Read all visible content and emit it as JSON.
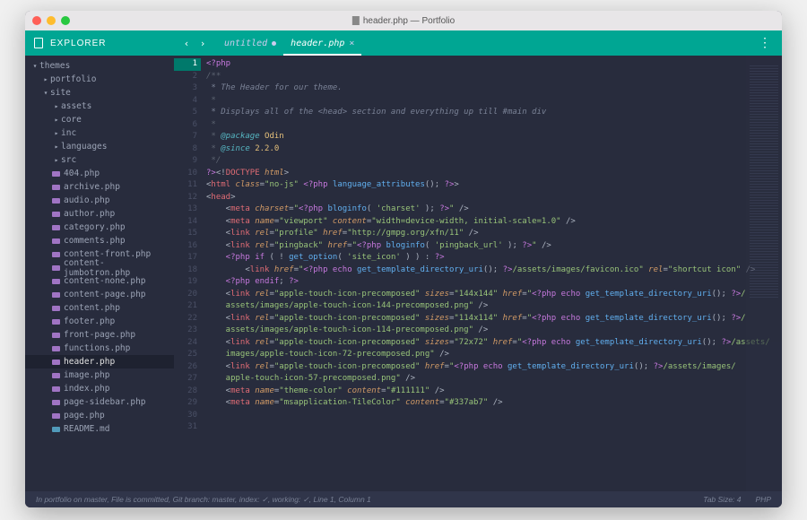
{
  "window": {
    "title": "header.php — Portfolio"
  },
  "sidebar": {
    "title": "EXPLORER",
    "tree": [
      {
        "label": "themes",
        "type": "folder",
        "indent": 0,
        "expanded": true
      },
      {
        "label": "portfolio",
        "type": "folder",
        "indent": 1,
        "expanded": false
      },
      {
        "label": "site",
        "type": "folder",
        "indent": 1,
        "expanded": true
      },
      {
        "label": "assets",
        "type": "folder",
        "indent": 2,
        "expanded": false
      },
      {
        "label": "core",
        "type": "folder",
        "indent": 2,
        "expanded": false
      },
      {
        "label": "inc",
        "type": "folder",
        "indent": 2,
        "expanded": false
      },
      {
        "label": "languages",
        "type": "folder",
        "indent": 2,
        "expanded": false
      },
      {
        "label": "src",
        "type": "folder",
        "indent": 2,
        "expanded": false
      },
      {
        "label": "404.php",
        "type": "php",
        "indent": 2
      },
      {
        "label": "archive.php",
        "type": "php",
        "indent": 2
      },
      {
        "label": "audio.php",
        "type": "php",
        "indent": 2
      },
      {
        "label": "author.php",
        "type": "php",
        "indent": 2
      },
      {
        "label": "category.php",
        "type": "php",
        "indent": 2
      },
      {
        "label": "comments.php",
        "type": "php",
        "indent": 2
      },
      {
        "label": "content-front.php",
        "type": "php",
        "indent": 2
      },
      {
        "label": "content-jumbotron.php",
        "type": "php",
        "indent": 2
      },
      {
        "label": "content-none.php",
        "type": "php",
        "indent": 2
      },
      {
        "label": "content-page.php",
        "type": "php",
        "indent": 2
      },
      {
        "label": "content.php",
        "type": "php",
        "indent": 2
      },
      {
        "label": "footer.php",
        "type": "php",
        "indent": 2
      },
      {
        "label": "front-page.php",
        "type": "php",
        "indent": 2
      },
      {
        "label": "functions.php",
        "type": "php",
        "indent": 2
      },
      {
        "label": "header.php",
        "type": "php",
        "indent": 2,
        "active": true
      },
      {
        "label": "image.php",
        "type": "php",
        "indent": 2
      },
      {
        "label": "index.php",
        "type": "php",
        "indent": 2
      },
      {
        "label": "page-sidebar.php",
        "type": "php",
        "indent": 2
      },
      {
        "label": "page.php",
        "type": "php",
        "indent": 2
      },
      {
        "label": "README.md",
        "type": "md",
        "indent": 2
      }
    ]
  },
  "tabs": [
    {
      "label": "untitled",
      "modified": true,
      "active": false
    },
    {
      "label": "header.php",
      "modified": false,
      "active": true
    }
  ],
  "code_lines": [
    {
      "n": 1,
      "segs": [
        [
          "<?",
          "kw"
        ],
        [
          "php",
          "kw"
        ]
      ],
      "cur": true
    },
    {
      "n": 2,
      "segs": [
        [
          "/**",
          "cm"
        ]
      ]
    },
    {
      "n": 3,
      "segs": [
        [
          " * The Header for our theme.",
          "cm2"
        ]
      ]
    },
    {
      "n": 4,
      "segs": [
        [
          " *",
          "cm"
        ]
      ]
    },
    {
      "n": 5,
      "segs": [
        [
          " * Displays all of the <head> section and everything up till #main div",
          "cm2"
        ]
      ]
    },
    {
      "n": 6,
      "segs": [
        [
          " *",
          "cm"
        ]
      ]
    },
    {
      "n": 7,
      "segs": [
        [
          " * ",
          "cm"
        ],
        [
          "@package",
          "pkg"
        ],
        [
          " Odin",
          "var"
        ]
      ]
    },
    {
      "n": 8,
      "segs": [
        [
          " * ",
          "cm"
        ],
        [
          "@since",
          "pkg"
        ],
        [
          " 2.2.0",
          "var"
        ]
      ]
    },
    {
      "n": 9,
      "segs": [
        [
          " */",
          "cm"
        ]
      ]
    },
    {
      "n": 10,
      "segs": [
        [
          "?>",
          "kw"
        ],
        [
          "<!",
          "punc"
        ],
        [
          "DOCTYPE",
          "tag"
        ],
        [
          " html",
          "attr"
        ],
        [
          ">",
          "punc"
        ]
      ]
    },
    {
      "n": 11,
      "segs": [
        [
          "<",
          "punc"
        ],
        [
          "html",
          "tag"
        ],
        [
          " class",
          "attr"
        ],
        [
          "=",
          "punc"
        ],
        [
          "\"no-js\"",
          "str"
        ],
        [
          " <?",
          "kw"
        ],
        [
          "php",
          "kw"
        ],
        [
          " language_attributes",
          "fn"
        ],
        [
          "(); ",
          "punc"
        ],
        [
          "?>",
          "kw"
        ],
        [
          ">",
          "punc"
        ]
      ]
    },
    {
      "n": 12,
      "segs": [
        [
          "<",
          "punc"
        ],
        [
          "head",
          "tag"
        ],
        [
          ">",
          "punc"
        ]
      ]
    },
    {
      "n": 13,
      "segs": [
        [
          "    <",
          "punc"
        ],
        [
          "meta",
          "tag"
        ],
        [
          " charset",
          "attr"
        ],
        [
          "=",
          "punc"
        ],
        [
          "\"",
          "str"
        ],
        [
          "<?",
          "kw"
        ],
        [
          "php",
          "kw"
        ],
        [
          " bloginfo",
          "fn"
        ],
        [
          "( ",
          "punc"
        ],
        [
          "'charset'",
          "str"
        ],
        [
          " ); ",
          "punc"
        ],
        [
          "?>",
          "kw"
        ],
        [
          "\"",
          "str"
        ],
        [
          " />",
          "punc"
        ]
      ]
    },
    {
      "n": 14,
      "segs": [
        [
          "    <",
          "punc"
        ],
        [
          "meta",
          "tag"
        ],
        [
          " name",
          "attr"
        ],
        [
          "=",
          "punc"
        ],
        [
          "\"viewport\"",
          "str"
        ],
        [
          " content",
          "attr"
        ],
        [
          "=",
          "punc"
        ],
        [
          "\"width=device-width, initial-scale=1.0\"",
          "str"
        ],
        [
          " />",
          "punc"
        ]
      ]
    },
    {
      "n": 15,
      "segs": [
        [
          "    <",
          "punc"
        ],
        [
          "link",
          "tag"
        ],
        [
          " rel",
          "attr"
        ],
        [
          "=",
          "punc"
        ],
        [
          "\"profile\"",
          "str"
        ],
        [
          " href",
          "attr"
        ],
        [
          "=",
          "punc"
        ],
        [
          "\"http://gmpg.org/xfn/11\"",
          "str"
        ],
        [
          " />",
          "punc"
        ]
      ]
    },
    {
      "n": 16,
      "segs": [
        [
          "    <",
          "punc"
        ],
        [
          "link",
          "tag"
        ],
        [
          " rel",
          "attr"
        ],
        [
          "=",
          "punc"
        ],
        [
          "\"pingback\"",
          "str"
        ],
        [
          " href",
          "attr"
        ],
        [
          "=",
          "punc"
        ],
        [
          "\"",
          "str"
        ],
        [
          "<?",
          "kw"
        ],
        [
          "php",
          "kw"
        ],
        [
          " bloginfo",
          "fn"
        ],
        [
          "( ",
          "punc"
        ],
        [
          "'pingback_url'",
          "str"
        ],
        [
          " ); ",
          "punc"
        ],
        [
          "?>",
          "kw"
        ],
        [
          "\"",
          "str"
        ],
        [
          " />",
          "punc"
        ]
      ]
    },
    {
      "n": 17,
      "segs": [
        [
          "    <?",
          "kw"
        ],
        [
          "php",
          "kw"
        ],
        [
          " if",
          "kw"
        ],
        [
          " ( ! ",
          "punc"
        ],
        [
          "get_option",
          "fn"
        ],
        [
          "( ",
          "punc"
        ],
        [
          "'site_icon'",
          "str"
        ],
        [
          " ) ) : ",
          "punc"
        ],
        [
          "?>",
          "kw"
        ]
      ]
    },
    {
      "n": 18,
      "segs": [
        [
          "        <",
          "punc"
        ],
        [
          "link",
          "tag"
        ],
        [
          " href",
          "attr"
        ],
        [
          "=",
          "punc"
        ],
        [
          "\"",
          "str"
        ],
        [
          "<?",
          "kw"
        ],
        [
          "php",
          "kw"
        ],
        [
          " echo",
          "kw"
        ],
        [
          " get_template_directory_uri",
          "fn"
        ],
        [
          "(); ",
          "punc"
        ],
        [
          "?>",
          "kw"
        ],
        [
          "/assets/images/favicon.ico\"",
          "str"
        ],
        [
          " rel",
          "attr"
        ],
        [
          "=",
          "punc"
        ],
        [
          "\"shortcut icon\"",
          "str"
        ],
        [
          " />",
          "punc"
        ]
      ]
    },
    {
      "n": 19,
      "segs": [
        [
          "    <?",
          "kw"
        ],
        [
          "php",
          "kw"
        ],
        [
          " endif",
          "kw"
        ],
        [
          "; ",
          "punc"
        ],
        [
          "?>",
          "kw"
        ]
      ]
    },
    {
      "n": 20,
      "segs": [
        [
          "",
          "punc"
        ]
      ]
    },
    {
      "n": 21,
      "segs": [
        [
          "    <",
          "punc"
        ],
        [
          "link",
          "tag"
        ],
        [
          " rel",
          "attr"
        ],
        [
          "=",
          "punc"
        ],
        [
          "\"apple-touch-icon-precomposed\"",
          "str"
        ],
        [
          " sizes",
          "attr"
        ],
        [
          "=",
          "punc"
        ],
        [
          "\"144x144\"",
          "str"
        ],
        [
          " href",
          "attr"
        ],
        [
          "=",
          "punc"
        ],
        [
          "\"",
          "str"
        ],
        [
          "<?",
          "kw"
        ],
        [
          "php",
          "kw"
        ],
        [
          " echo",
          "kw"
        ],
        [
          " get_template_directory_uri",
          "fn"
        ],
        [
          "(); ",
          "punc"
        ],
        [
          "?>",
          "kw"
        ],
        [
          "/",
          "str"
        ]
      ]
    },
    {
      "n": 22,
      "segs": [
        [
          "    assets/images/apple-touch-icon-144-precomposed.png\"",
          "str"
        ],
        [
          " />",
          "punc"
        ]
      ]
    },
    {
      "n": 23,
      "segs": [
        [
          "    <",
          "punc"
        ],
        [
          "link",
          "tag"
        ],
        [
          " rel",
          "attr"
        ],
        [
          "=",
          "punc"
        ],
        [
          "\"apple-touch-icon-precomposed\"",
          "str"
        ],
        [
          " sizes",
          "attr"
        ],
        [
          "=",
          "punc"
        ],
        [
          "\"114x114\"",
          "str"
        ],
        [
          " href",
          "attr"
        ],
        [
          "=",
          "punc"
        ],
        [
          "\"",
          "str"
        ],
        [
          "<?",
          "kw"
        ],
        [
          "php",
          "kw"
        ],
        [
          " echo",
          "kw"
        ],
        [
          " get_template_directory_uri",
          "fn"
        ],
        [
          "(); ",
          "punc"
        ],
        [
          "?>",
          "kw"
        ],
        [
          "/",
          "str"
        ]
      ]
    },
    {
      "n": 24,
      "segs": [
        [
          "    assets/images/apple-touch-icon-114-precomposed.png\"",
          "str"
        ],
        [
          " />",
          "punc"
        ]
      ]
    },
    {
      "n": 25,
      "segs": [
        [
          "    <",
          "punc"
        ],
        [
          "link",
          "tag"
        ],
        [
          " rel",
          "attr"
        ],
        [
          "=",
          "punc"
        ],
        [
          "\"apple-touch-icon-precomposed\"",
          "str"
        ],
        [
          " sizes",
          "attr"
        ],
        [
          "=",
          "punc"
        ],
        [
          "\"72x72\"",
          "str"
        ],
        [
          " href",
          "attr"
        ],
        [
          "=",
          "punc"
        ],
        [
          "\"",
          "str"
        ],
        [
          "<?",
          "kw"
        ],
        [
          "php",
          "kw"
        ],
        [
          " echo",
          "kw"
        ],
        [
          " get_template_directory_uri",
          "fn"
        ],
        [
          "(); ",
          "punc"
        ],
        [
          "?>",
          "kw"
        ],
        [
          "/assets/",
          "str"
        ]
      ]
    },
    {
      "n": 26,
      "segs": [
        [
          "    images/apple-touch-icon-72-precomposed.png\"",
          "str"
        ],
        [
          " />",
          "punc"
        ]
      ]
    },
    {
      "n": 27,
      "segs": [
        [
          "    <",
          "punc"
        ],
        [
          "link",
          "tag"
        ],
        [
          " rel",
          "attr"
        ],
        [
          "=",
          "punc"
        ],
        [
          "\"apple-touch-icon-precomposed\"",
          "str"
        ],
        [
          " href",
          "attr"
        ],
        [
          "=",
          "punc"
        ],
        [
          "\"",
          "str"
        ],
        [
          "<?",
          "kw"
        ],
        [
          "php",
          "kw"
        ],
        [
          " echo",
          "kw"
        ],
        [
          " get_template_directory_uri",
          "fn"
        ],
        [
          "(); ",
          "punc"
        ],
        [
          "?>",
          "kw"
        ],
        [
          "/assets/images/",
          "str"
        ]
      ]
    },
    {
      "n": 28,
      "segs": [
        [
          "    apple-touch-icon-57-precomposed.png\"",
          "str"
        ],
        [
          " />",
          "punc"
        ]
      ]
    },
    {
      "n": 29,
      "segs": [
        [
          "",
          "punc"
        ]
      ]
    },
    {
      "n": 30,
      "segs": [
        [
          "    <",
          "punc"
        ],
        [
          "meta",
          "tag"
        ],
        [
          " name",
          "attr"
        ],
        [
          "=",
          "punc"
        ],
        [
          "\"theme-color\"",
          "str"
        ],
        [
          " content",
          "attr"
        ],
        [
          "=",
          "punc"
        ],
        [
          "\"#111111\"",
          "str"
        ],
        [
          " />",
          "punc"
        ]
      ]
    },
    {
      "n": 31,
      "segs": [
        [
          "    <",
          "punc"
        ],
        [
          "meta",
          "tag"
        ],
        [
          " name",
          "attr"
        ],
        [
          "=",
          "punc"
        ],
        [
          "\"msapplication-TileColor\"",
          "str"
        ],
        [
          " content",
          "attr"
        ],
        [
          "=",
          "punc"
        ],
        [
          "\"#337ab7\"",
          "str"
        ],
        [
          " />",
          "punc"
        ]
      ]
    }
  ],
  "statusbar": {
    "left": "In portfolio on master, File is committed, Git branch: master, index: ✓, working: ✓, Line 1, Column 1",
    "tab_size_label": "Tab Size:",
    "tab_size_value": "4",
    "lang": "PHP"
  }
}
